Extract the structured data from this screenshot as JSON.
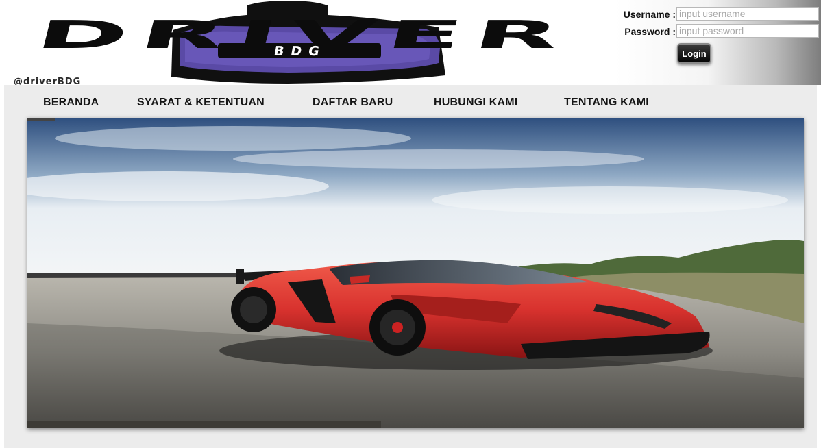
{
  "header": {
    "logo_text": "DRIVER",
    "logo_sub": "BDG",
    "handle": "@driverBDG"
  },
  "login": {
    "username_label": "Username :",
    "username_placeholder": "input username",
    "password_label": "Password :",
    "password_placeholder": "input password",
    "button_label": "Login"
  },
  "nav": {
    "items": [
      {
        "label": "BERANDA"
      },
      {
        "label": "SYARAT & KETENTUAN"
      },
      {
        "label": "DAFTAR BARU"
      },
      {
        "label": "HUBUNGI KAMI"
      },
      {
        "label": "TENTANG KAMI"
      }
    ]
  },
  "hero": {
    "subject": "red sports car on track",
    "colors": {
      "sky_top": "#2e4f7f",
      "sky_bottom": "#e8eef3",
      "car": "#d8322e",
      "road": "#8d8b84"
    }
  }
}
